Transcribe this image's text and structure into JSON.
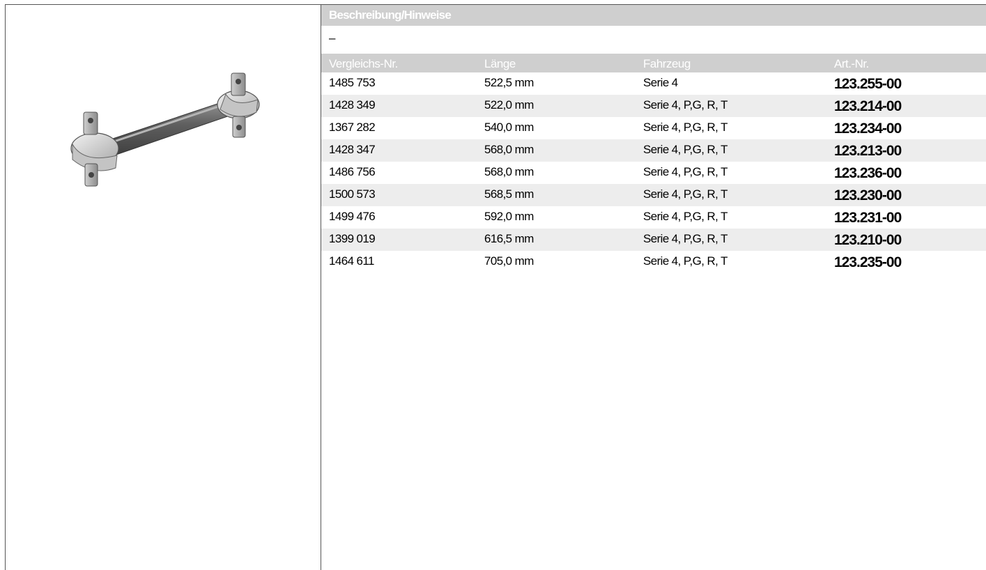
{
  "description": {
    "header": "Beschreibung/Hinweise",
    "text": "–"
  },
  "table": {
    "headers": [
      "Vergleichs-Nr.",
      "Länge",
      "Fahrzeug",
      "Art.-Nr."
    ],
    "rows": [
      {
        "vergleichs_nr": "1485 753",
        "laenge": "522,5 mm",
        "fahrzeug": "Serie 4",
        "art_nr": "123.255-00"
      },
      {
        "vergleichs_nr": "1428 349",
        "laenge": "522,0 mm",
        "fahrzeug": "Serie 4, P,G, R, T",
        "art_nr": "123.214-00"
      },
      {
        "vergleichs_nr": "1367 282",
        "laenge": "540,0 mm",
        "fahrzeug": "Serie 4, P,G, R, T",
        "art_nr": "123.234-00"
      },
      {
        "vergleichs_nr": "1428 347",
        "laenge": "568,0 mm",
        "fahrzeug": "Serie 4, P,G, R, T",
        "art_nr": "123.213-00"
      },
      {
        "vergleichs_nr": "1486 756",
        "laenge": "568,0 mm",
        "fahrzeug": "Serie 4, P,G, R, T",
        "art_nr": "123.236-00"
      },
      {
        "vergleichs_nr": "1500 573",
        "laenge": "568,5 mm",
        "fahrzeug": "Serie 4, P,G, R, T",
        "art_nr": "123.230-00"
      },
      {
        "vergleichs_nr": "1499 476",
        "laenge": "592,0 mm",
        "fahrzeug": "Serie 4, P,G, R, T",
        "art_nr": "123.231-00"
      },
      {
        "vergleichs_nr": "1399 019",
        "laenge": "616,5 mm",
        "fahrzeug": "Serie 4, P,G, R, T",
        "art_nr": "123.210-00"
      },
      {
        "vergleichs_nr": "1464 611",
        "laenge": "705,0 mm",
        "fahrzeug": "Serie 4, P,G, R, T",
        "art_nr": "123.235-00"
      }
    ]
  },
  "colors": {
    "header_bg": "#cfcfcf",
    "row_shade": "#ededed",
    "border": "#555555"
  },
  "image": {
    "icon": "torque-rod-image"
  }
}
